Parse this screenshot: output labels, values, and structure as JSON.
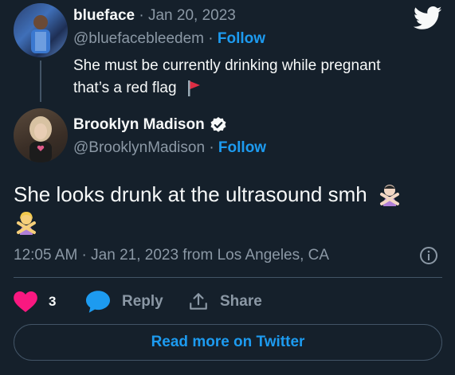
{
  "reply_tweet": {
    "author_name": "blueface",
    "date": "Jan 20, 2023",
    "handle": "@bluefacebleedem",
    "follow_label": "Follow",
    "text_line1": "She must be currently drinking while pregnant",
    "text_line2": "that’s a red flag"
  },
  "main_tweet": {
    "author_name": "Brooklyn Madison",
    "verified": true,
    "handle": "@BrooklynMadison",
    "follow_label": "Follow",
    "text": "She looks drunk at the ultrasound smh",
    "timestamp": "12:05 AM · Jan 21, 2023 from Los Angeles, CA"
  },
  "actions": {
    "like_count": "3",
    "reply_label": "Reply",
    "share_label": "Share"
  },
  "read_more_label": "Read more on Twitter",
  "colors": {
    "background": "#15202b",
    "accent": "#1d9bf0",
    "like": "#f91880",
    "muted": "#8b98a5",
    "border": "#425466"
  },
  "icons": [
    "twitter-bird-icon",
    "verified-badge-icon",
    "red-flag-emoji",
    "person-gesturing-no-emoji",
    "info-icon",
    "heart-icon",
    "reply-bubble-icon",
    "share-icon"
  ]
}
